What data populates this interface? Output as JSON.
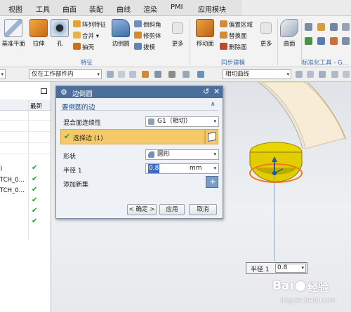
{
  "menu": [
    "视图",
    "工具",
    "曲面",
    "装配",
    "曲线",
    "渲染",
    "PMI",
    "应用模块"
  ],
  "ribbon": {
    "big_buttons": [
      {
        "label": "基准平面",
        "icon": "datum-plane-icon"
      },
      {
        "label": "拉伸",
        "icon": "extrude-icon"
      },
      {
        "label": "孔",
        "icon": "hole-icon"
      },
      {
        "label": "边倒圆",
        "icon": "edge-blend-icon"
      },
      {
        "label": "更多",
        "icon": "more-icon"
      },
      {
        "label": "移动面",
        "icon": "move-face-icon"
      },
      {
        "label": "更多",
        "icon": "more-icon"
      },
      {
        "label": "曲面",
        "icon": "surface-icon"
      }
    ],
    "small_buttons": [
      {
        "label": "阵列特征",
        "icon": "pattern-feature-icon"
      },
      {
        "label": "合并 ▾",
        "icon": "unite-icon"
      },
      {
        "label": "抽壳",
        "icon": "shell-icon"
      },
      {
        "label": "倒斜角",
        "icon": "chamfer-icon"
      },
      {
        "label": "修剪体",
        "icon": "trim-body-icon"
      },
      {
        "label": "拔模",
        "icon": "draft-icon"
      },
      {
        "label": "偏置区域",
        "icon": "offset-region-icon"
      },
      {
        "label": "替换面",
        "icon": "replace-face-icon"
      },
      {
        "label": "删除面",
        "icon": "delete-face-icon"
      }
    ],
    "groups": [
      "特征",
      "同步建模",
      "标准化工具 - G..."
    ]
  },
  "filterbar": {
    "scope_value": "仅在工作部件内",
    "curve_rule_value": "相切曲线"
  },
  "navigator": {
    "column_header": "最新",
    "rows": [
      {
        "text": ")",
        "check": "✔"
      },
      {
        "text": "TCH_0...",
        "check": "✔"
      },
      {
        "text": "TCH_0...",
        "check": "✔"
      },
      {
        "text": "",
        "check": "✔"
      },
      {
        "text": "",
        "check": "✔"
      },
      {
        "text": "",
        "check": "✔"
      }
    ]
  },
  "dialog": {
    "title": "边倒圆",
    "section_title": "要倒圆的边",
    "continuity_label": "混合面连续性",
    "continuity_value": "G1（相切）",
    "select_edge_label": "选择边 (1)",
    "shape_label": "形状",
    "shape_value": "圆形",
    "radius_label": "半径 1",
    "radius_value": "0.8",
    "radius_unit": "mm",
    "add_new_set_label": "添加新集",
    "ok_label": "< 确定 >",
    "apply_label": "应用",
    "cancel_label": "取消"
  },
  "onscreen_input": {
    "label": "半径 1",
    "value": "0.8"
  },
  "watermark": {
    "brand": "Bai",
    "brand_tail": "经验",
    "url": "jingyan.baidu.com"
  },
  "colors": {
    "accent": "#4a6f9c",
    "selection": "#f5c96a",
    "check": "#1e9e2a",
    "yellow_face": "#e8d000"
  }
}
